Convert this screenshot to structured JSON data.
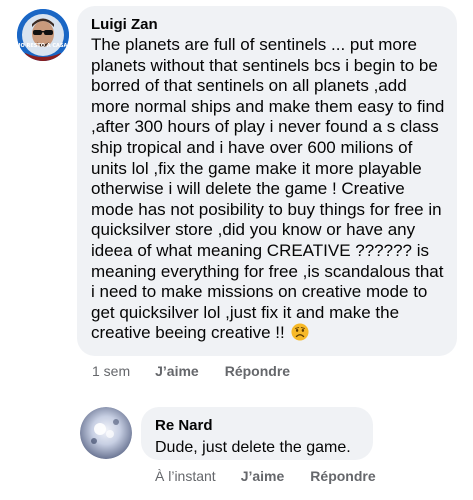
{
  "comments": [
    {
      "author": "Luigi Zan",
      "avatar_badge": "IO RESTO A CASA",
      "text": "The planets are full of sentinels ... put more planets without that sentinels bcs i begin to be borred of that sentinels on all planets ,add more normal ships and make them easy to find ,after 300 hours of play i never found a s class ship tropical and i have over 600 milions of units lol ,fix the game make it more playable otherwise i will delete the game ! Creative mode has not posibility to buy things for free in quicksilver store ,did you know or have any ideea of what meaning CREATIVE ?????? is meaning everything for free ,is scandalous that i need to make missions on creative mode to get quicksilver lol ,just fix it and make the creative beeing creative !!",
      "emoji": "worried-face-icon",
      "time": "1 sem",
      "like_label": "J’aime",
      "reply_label": "Répondre"
    },
    {
      "author": "Re Nard",
      "text": "Dude, just delete the game.",
      "time": "À l’instant",
      "like_label": "J’aime",
      "reply_label": "Répondre"
    }
  ],
  "colors": {
    "bubble_bg": "#f0f2f5",
    "text": "#050505",
    "meta_text": "#65676b"
  }
}
